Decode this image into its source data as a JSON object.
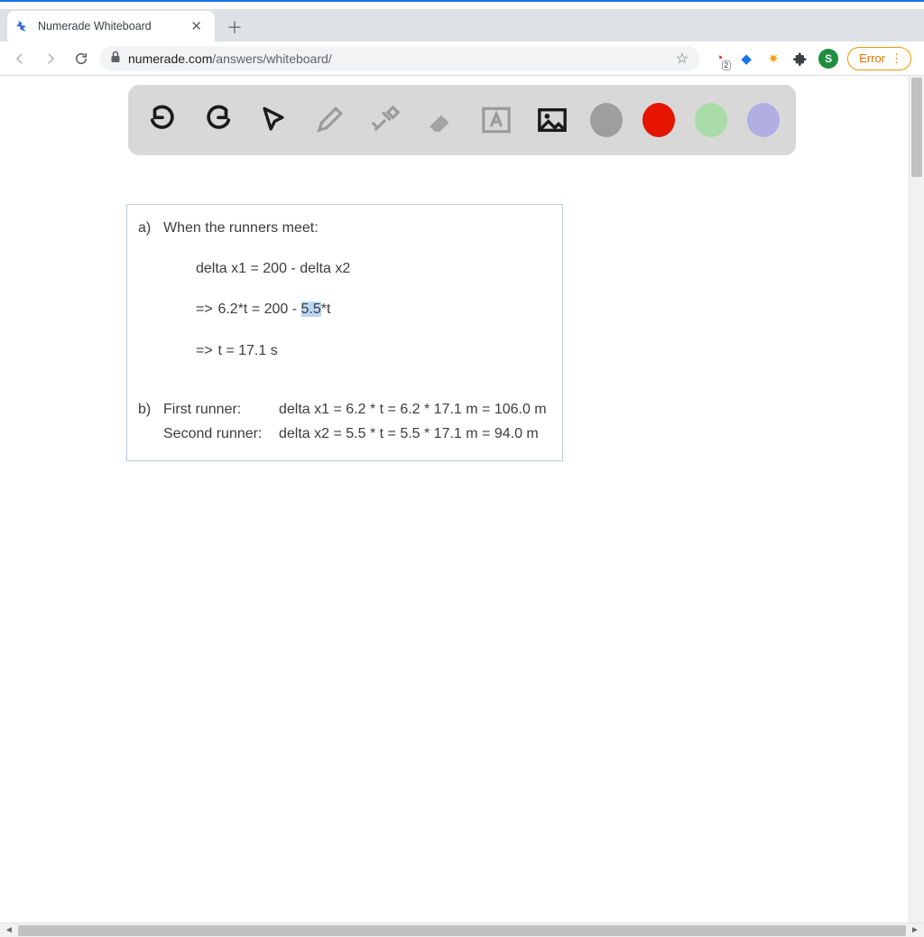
{
  "window": {
    "tab_title": "Numerade Whiteboard",
    "url_host": "numerade.com",
    "url_path": "/answers/whiteboard/"
  },
  "addressbar": {
    "error_label": "Error",
    "avatar_initial": "S",
    "ext_badge": "2"
  },
  "toolbar": {
    "colors": {
      "gray": "#9e9e9e",
      "red": "#e51400",
      "green": "#a9dca7",
      "purple": "#b0aee3"
    }
  },
  "whiteboard": {
    "a_label": "a)",
    "a_heading": "When the runners meet:",
    "a_line1": "delta x1 = 200 - delta x2",
    "a_line2_pre": "6.2*t = 200 - ",
    "a_line2_hl": "5.5",
    "a_line2_post": "*t",
    "a_line3": "t = 17.1  s",
    "arrow": "=>",
    "b_label": "b)",
    "b_r1_label": "First runner:",
    "b_r1_value": "delta x1 = 6.2 * t = 6.2 * 17.1  m  =   106.0 m",
    "b_r2_label": "Second runner:",
    "b_r2_value": "delta x2 = 5.5 * t = 5.5 * 17.1  m  =    94.0  m"
  }
}
